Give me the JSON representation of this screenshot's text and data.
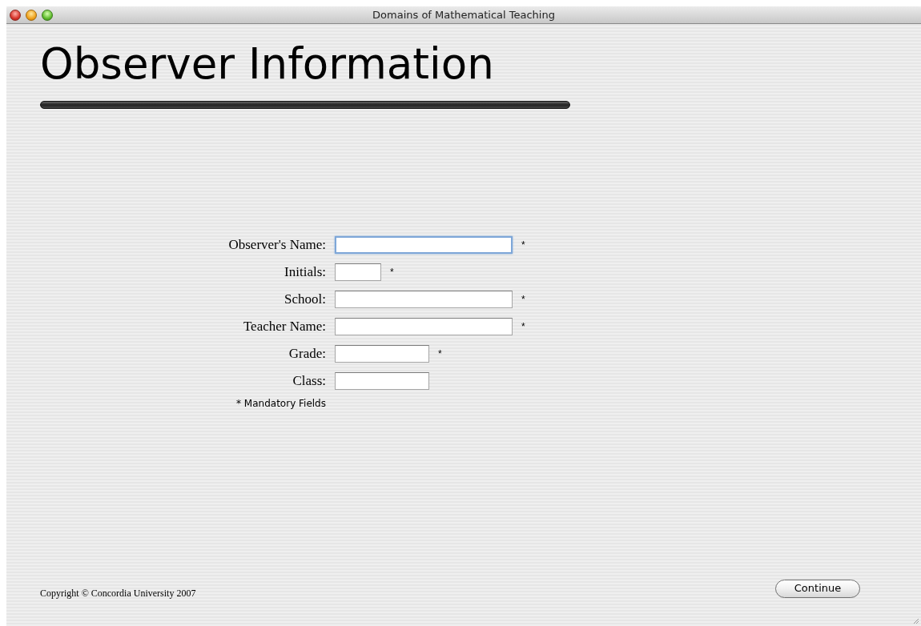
{
  "window": {
    "title": "Domains of Mathematical Teaching"
  },
  "heading": "Observer Information",
  "form": {
    "fields": [
      {
        "label": "Observer's Name:",
        "kind": "long",
        "required_mark": "*",
        "focused": true
      },
      {
        "label": "Initials:",
        "kind": "short",
        "required_mark": "*",
        "focused": false
      },
      {
        "label": "School:",
        "kind": "long",
        "required_mark": "*",
        "focused": false
      },
      {
        "label": "Teacher Name:",
        "kind": "long",
        "required_mark": "*",
        "focused": false
      },
      {
        "label": "Grade:",
        "kind": "medium",
        "required_mark": "*",
        "focused": false
      },
      {
        "label": "Class:",
        "kind": "medium",
        "focused": false
      }
    ],
    "note": "* Mandatory Fields"
  },
  "footer": {
    "copyright": "Copyright © Concordia University 2007",
    "button": "Continue"
  }
}
